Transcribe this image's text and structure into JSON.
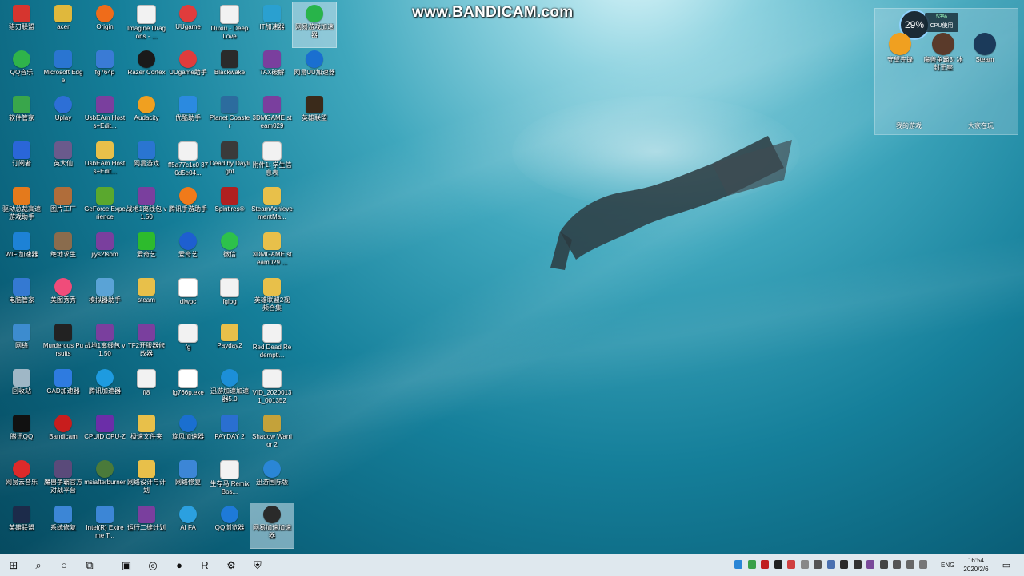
{
  "watermark": "www.BANDICAM.com",
  "desktop": {
    "columns": [
      [
        {
          "label": "猎刃联盟",
          "icon": "app-icon",
          "color": "#d6352f"
        },
        {
          "label": "QQ音乐",
          "icon": "music-icon",
          "color": "#2fb34a",
          "round": true
        },
        {
          "label": "软件管家",
          "icon": "software-icon",
          "color": "#39a64b"
        },
        {
          "label": "订阅者",
          "icon": "shield-icon",
          "color": "#2a66d8"
        },
        {
          "label": "驱动总裁高速游戏助手",
          "icon": "tool-icon",
          "color": "#e47a1c"
        },
        {
          "label": "WIFI加速器",
          "icon": "wifi-icon",
          "color": "#1d82d6"
        },
        {
          "label": "电脑管家",
          "icon": "pc-icon",
          "color": "#3479d2"
        },
        {
          "label": "网络",
          "icon": "network-icon",
          "color": "#3d8ccf"
        },
        {
          "label": "回收站",
          "icon": "recycle-bin-icon",
          "color": "#9fb7c6"
        },
        {
          "label": "腾讯QQ",
          "icon": "qq-icon",
          "color": "#111111"
        },
        {
          "label": "网易云音乐",
          "icon": "netease-music-icon",
          "color": "#dd2a2a",
          "round": true
        },
        {
          "label": "英雄联盟",
          "icon": "lol-icon",
          "color": "#1c2b4a"
        }
      ],
      [
        {
          "label": "acer",
          "icon": "folder-user-icon",
          "color": "#e0b83c"
        },
        {
          "label": "Microsoft Edge",
          "icon": "edge-icon",
          "color": "#2a75d1"
        },
        {
          "label": "Uplay",
          "icon": "uplay-icon",
          "color": "#2d6fd6",
          "round": true
        },
        {
          "label": "英大仙",
          "icon": "game-icon",
          "color": "#6a5a8c"
        },
        {
          "label": "图片工厂",
          "icon": "image-tool-icon",
          "color": "#b06d3a"
        },
        {
          "label": "绝地求生",
          "icon": "game-icon",
          "color": "#8a6c4d"
        },
        {
          "label": "美图秀秀",
          "icon": "meitu-icon",
          "color": "#f04c7a",
          "round": true
        },
        {
          "label": "Murderous Pursuits",
          "icon": "game-icon",
          "color": "#222222"
        },
        {
          "label": "GAD加速器",
          "icon": "accelerator-icon",
          "color": "#2e7be0"
        },
        {
          "label": "Bandicam",
          "icon": "bandicam-icon",
          "color": "#c81d1d",
          "round": true
        },
        {
          "label": "魔兽争霸官方对战平台",
          "icon": "warcraft-icon",
          "color": "#5a4a7a"
        },
        {
          "label": "系统修复",
          "icon": "repair-icon",
          "color": "#3c86d6"
        }
      ],
      [
        {
          "label": "Origin",
          "icon": "origin-icon",
          "color": "#ef6c1a",
          "round": true
        },
        {
          "label": "fg764p",
          "icon": "plane-icon",
          "color": "#3a7bd5"
        },
        {
          "label": "UsbEAm Hosts+Edit...",
          "icon": "winrar-icon",
          "color": "#7a3f9e"
        },
        {
          "label": "UsbEAm Hosts+Edit...",
          "icon": "folder-icon",
          "color": "#e8c04a"
        },
        {
          "label": "GeForce Experience",
          "icon": "nvidia-icon",
          "color": "#5aa82e"
        },
        {
          "label": "jiys2tsom",
          "icon": "winrar-icon",
          "color": "#7a3f9e"
        },
        {
          "label": "模拟器助手",
          "icon": "emulator-icon",
          "color": "#5aa3d6"
        },
        {
          "label": "战地1离线包 v1.50",
          "icon": "winrar-icon",
          "color": "#7a3f9e"
        },
        {
          "label": "腾讯加速器",
          "icon": "accelerator-icon",
          "color": "#1e9be0",
          "round": true
        },
        {
          "label": "CPUID CPU-Z",
          "icon": "cpuz-icon",
          "color": "#6b2ea8"
        },
        {
          "label": "msiafterburner",
          "icon": "msi-icon",
          "color": "#4a7a3a",
          "round": true
        },
        {
          "label": "Intel(R) Extreme T...",
          "icon": "intel-icon",
          "color": "#3c86d6"
        }
      ],
      [
        {
          "label": "Imagine Dragons - ...",
          "icon": "media-file-icon",
          "color": "#f2f2f2",
          "dark": true
        },
        {
          "label": "Razer Cortex",
          "icon": "razer-icon",
          "color": "#1a1a1a",
          "round": true
        },
        {
          "label": "Audacity",
          "icon": "audacity-icon",
          "color": "#f0a020",
          "round": true
        },
        {
          "label": "网易游戏",
          "icon": "edge-icon",
          "color": "#2a75d1"
        },
        {
          "label": "战地1离线包 v1.50",
          "icon": "winrar-icon",
          "color": "#7a3f9e"
        },
        {
          "label": "爱奇艺",
          "icon": "iqiyi-icon",
          "color": "#2dbb2d"
        },
        {
          "label": "steam",
          "icon": "folder-icon",
          "color": "#e8c04a"
        },
        {
          "label": "TF2开服器修改器",
          "icon": "winrar-icon",
          "color": "#7a3f9e"
        },
        {
          "label": "ff8",
          "icon": "text-file-icon",
          "color": "#f2f2f2",
          "dark": true
        },
        {
          "label": "极速文件夹",
          "icon": "folder-icon",
          "color": "#e8c04a"
        },
        {
          "label": "网络设计与计划",
          "icon": "folder-icon",
          "color": "#e8c04a"
        },
        {
          "label": "运行二维计划",
          "icon": "winrar-icon",
          "color": "#7a3f9e"
        }
      ],
      [
        {
          "label": "UUgame",
          "icon": "uu-icon",
          "color": "#e03c3c",
          "round": true
        },
        {
          "label": "UUgame助手",
          "icon": "uu-icon",
          "color": "#e03c3c",
          "round": true
        },
        {
          "label": "优酷助手",
          "icon": "youku-icon",
          "color": "#2b8ae0"
        },
        {
          "label": "ff5a77c1c0 370d5e04...",
          "icon": "doc-file-icon",
          "color": "#f2f2f2",
          "dark": true
        },
        {
          "label": "腾讯手游助手",
          "icon": "tencent-icon",
          "color": "#f07a1a",
          "round": true
        },
        {
          "label": "爱奇艺",
          "icon": "qq-icon",
          "color": "#1e5fd0",
          "round": true
        },
        {
          "label": "dlwpc",
          "icon": "blank-file-icon",
          "color": "#ffffff",
          "dark": true
        },
        {
          "label": "fg",
          "icon": "gear-file-icon",
          "color": "#f2f2f2",
          "dark": true
        },
        {
          "label": "fg766p.exe",
          "icon": "blank-file-icon",
          "color": "#ffffff",
          "dark": true
        },
        {
          "label": "旋风加速器",
          "icon": "swirl-icon",
          "color": "#1a6fd0",
          "round": true
        },
        {
          "label": "网络修复",
          "icon": "repair-icon",
          "color": "#3c86d6"
        },
        {
          "label": "AI FA",
          "icon": "telegram-icon",
          "color": "#2ba0e0",
          "round": true
        }
      ],
      [
        {
          "label": "Duxiu - Deep Love",
          "icon": "media-file-icon",
          "color": "#f2f2f2",
          "dark": true
        },
        {
          "label": "Blackwake",
          "icon": "game-icon",
          "color": "#2a2a2a"
        },
        {
          "label": "Planet Coaster",
          "icon": "coaster-icon",
          "color": "#2c6c9e"
        },
        {
          "label": "Dead by Daylight",
          "icon": "dbd-icon",
          "color": "#3a3a3a"
        },
        {
          "label": "Spintires®",
          "icon": "star-icon",
          "color": "#b02020"
        },
        {
          "label": "微信",
          "icon": "wechat-icon",
          "color": "#2dc14b",
          "round": true
        },
        {
          "label": "fglog",
          "icon": "text-file-icon",
          "color": "#f2f2f2",
          "dark": true
        },
        {
          "label": "Payday2",
          "icon": "folder-icon",
          "color": "#e8c04a"
        },
        {
          "label": "迅游加速加速器5.0",
          "icon": "edge-icon",
          "color": "#1c8fd8",
          "round": true
        },
        {
          "label": "PAYDAY 2",
          "icon": "payday-icon",
          "color": "#2a6fd0"
        },
        {
          "label": "生存马 Remix Bos...",
          "icon": "media-file-icon",
          "color": "#f2f2f2",
          "dark": true
        },
        {
          "label": "QQ浏览器",
          "icon": "browser-icon",
          "color": "#1e7ad8",
          "round": true
        }
      ],
      [
        {
          "label": "IT加速器",
          "icon": "edge-icon",
          "color": "#2aa0d0"
        },
        {
          "label": "TAX破解",
          "icon": "winrar-icon",
          "color": "#7a3f9e"
        },
        {
          "label": "3DMGAME steam029",
          "icon": "winrar-icon",
          "color": "#7a3f9e"
        },
        {
          "label": "附件1: 学生信息表",
          "icon": "excel-icon",
          "color": "#f2f2f2",
          "dark": true
        },
        {
          "label": "SteamAchievementMa...",
          "icon": "folder-icon",
          "color": "#e8c04a"
        },
        {
          "label": "3DMGAME steam029 ...",
          "icon": "folder-icon",
          "color": "#e8c04a"
        },
        {
          "label": "英雄联盟2视频合集",
          "icon": "folder-icon",
          "color": "#e8c04a"
        },
        {
          "label": "Red Dead Redempti...",
          "icon": "doc-file-icon",
          "color": "#f2f2f2",
          "dark": true
        },
        {
          "label": "VID_2020013 1_001352",
          "icon": "video-file-icon",
          "color": "#f2f2f2",
          "dark": true
        },
        {
          "label": "Shadow Warrior 2",
          "icon": "sw-icon",
          "color": "#c4a23a"
        },
        {
          "label": "迅游国际版",
          "icon": "globe-icon",
          "color": "#2a86d6",
          "round": true
        },
        {
          "label": "网易加速加速器",
          "icon": "netease-icon",
          "color": "#2a2a2a",
          "round": true,
          "selected": true
        }
      ],
      [
        {
          "label": "网易游戏加速器",
          "icon": "accelerator-icon",
          "color": "#28b44a",
          "round": true,
          "selected": true
        },
        {
          "label": "网易UU加速器",
          "icon": "uu-icon",
          "color": "#1a6fd0",
          "round": true
        },
        {
          "label": "英雄联盟",
          "icon": "lol-icon",
          "color": "#3a2a1a"
        }
      ]
    ]
  },
  "widget": {
    "cpu_percent": "29%",
    "cpu_usage": "53%",
    "cpu_label": "CPU使用",
    "apps": [
      {
        "label": "守望先锋",
        "icon": "overwatch-icon",
        "color": "#f0a020"
      },
      {
        "label": "魔兽争霸3: 冰封王座",
        "icon": "warcraft-icon",
        "color": "#5a3a2a"
      },
      {
        "label": "Steam",
        "icon": "steam-icon",
        "color": "#1b3a5a"
      }
    ],
    "footer_left": "我的游戏",
    "footer_right": "大家在玩"
  },
  "taskbar": {
    "buttons": [
      {
        "name": "start-button",
        "glyph": "⊞"
      },
      {
        "name": "search-button",
        "glyph": "⌕"
      },
      {
        "name": "cortana-button",
        "glyph": "○"
      },
      {
        "name": "task-view-button",
        "glyph": "⧉"
      },
      {
        "name": "taskbar-app-1",
        "glyph": "▣"
      },
      {
        "name": "taskbar-steam",
        "glyph": "◎"
      },
      {
        "name": "taskbar-bandicam",
        "glyph": "●"
      },
      {
        "name": "taskbar-app-r",
        "glyph": "R"
      },
      {
        "name": "taskbar-settings",
        "glyph": "⚙"
      },
      {
        "name": "taskbar-app-shield",
        "glyph": "⛨"
      }
    ],
    "tray_colors": [
      "#2a86d6",
      "#3aa04a",
      "#c02020",
      "#222222",
      "#d04040",
      "#888888",
      "#555555",
      "#4a70b0",
      "#2a2a2a",
      "#333333",
      "#7a4a9a",
      "#444444",
      "#555555",
      "#666666",
      "#777777"
    ],
    "language": "ENG",
    "time": "16:54",
    "date": "2020/2/6"
  }
}
